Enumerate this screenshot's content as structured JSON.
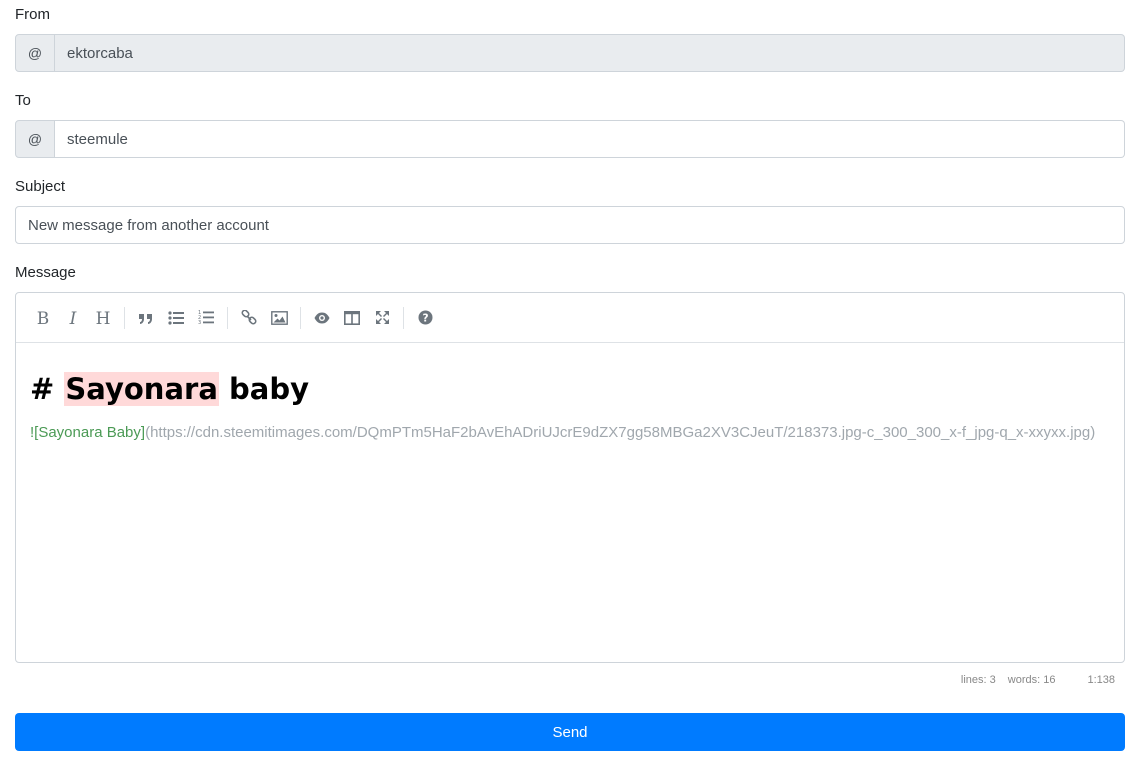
{
  "from": {
    "label": "From",
    "prefix": "@",
    "value": "ektorcaba"
  },
  "to": {
    "label": "To",
    "prefix": "@",
    "value": "steemule"
  },
  "subject": {
    "label": "Subject",
    "value": "New message from another account"
  },
  "message": {
    "label": "Message",
    "toolbar": [
      "bold-icon",
      "italic-icon",
      "heading-icon",
      "quote-icon",
      "unordered-list-icon",
      "ordered-list-icon",
      "link-icon",
      "image-icon",
      "preview-icon",
      "side-by-side-icon",
      "fullscreen-icon",
      "help-icon"
    ],
    "heading_hash": "# ",
    "heading_highlight": "Sayonara",
    "heading_rest": " baby",
    "image_alt": "![Sayonara Baby]",
    "image_url": "(https://cdn.steemitimages.com/DQmPTm5HaF2bAvEhADriUJcrE9dZX7gg58MBGa2XV3CJeuT/218373.jpg-c_300_300_x-f_jpg-q_x-xxyxx.jpg)"
  },
  "statusbar": {
    "lines": "lines: 3",
    "words": "words: 16",
    "cursor": "1:138"
  },
  "send_label": "Send",
  "colors": {
    "accent": "#007bff",
    "highlight": "#ffd9d9",
    "link_alt": "#4b9a55"
  }
}
